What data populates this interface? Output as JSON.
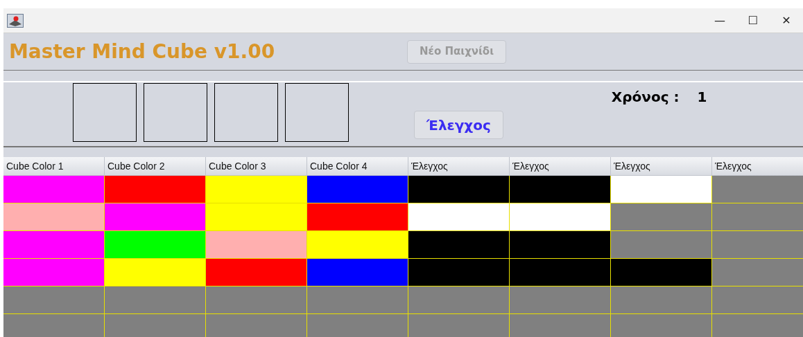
{
  "window": {
    "title_buttons": [
      "—",
      "☐",
      "✕"
    ]
  },
  "header": {
    "title": "Master Mind Cube v1.00",
    "new_game_button": {
      "label": "Νέο Παιχνίδι",
      "disabled": true
    }
  },
  "guess_slots": [
    {
      "filled": false
    },
    {
      "filled": false
    },
    {
      "filled": false
    },
    {
      "filled": false
    }
  ],
  "check_button": {
    "label": "Έλεγχος"
  },
  "timer": {
    "label": "Χρόνος :",
    "value": "1"
  },
  "table": {
    "columns": [
      "Cube Color 1",
      "Cube Color 2",
      "Cube Color 3",
      "Cube Color 4",
      "Έλεγχος",
      "Έλεγχος",
      "Έλεγχος",
      "Έλεγχος"
    ],
    "rows": [
      {
        "cells": [
          {
            "color": "#ff00ff"
          },
          {
            "color": "#ff0000"
          },
          {
            "color": "#ffff00"
          },
          {
            "color": "#0000ff"
          },
          {
            "color": "#000000"
          },
          {
            "color": "#000000"
          },
          {
            "color": "#ffffff"
          },
          {
            "color": "#808080"
          }
        ]
      },
      {
        "cells": [
          {
            "color": "#ffafaf"
          },
          {
            "color": "#ff00ff"
          },
          {
            "color": "#ffff00"
          },
          {
            "color": "#ff0000"
          },
          {
            "color": "#ffffff"
          },
          {
            "color": "#ffffff"
          },
          {
            "color": "#808080"
          },
          {
            "color": "#808080"
          }
        ]
      },
      {
        "cells": [
          {
            "color": "#ff00ff"
          },
          {
            "color": "#00ff00"
          },
          {
            "color": "#ffafaf"
          },
          {
            "color": "#ffff00"
          },
          {
            "color": "#000000"
          },
          {
            "color": "#000000"
          },
          {
            "color": "#808080"
          },
          {
            "color": "#808080"
          }
        ]
      },
      {
        "cells": [
          {
            "color": "#ff00ff"
          },
          {
            "color": "#ffff00"
          },
          {
            "color": "#ff0000"
          },
          {
            "color": "#0000ff"
          },
          {
            "color": "#000000"
          },
          {
            "color": "#000000"
          },
          {
            "color": "#000000"
          },
          {
            "color": "#808080"
          }
        ]
      },
      {
        "cells": [
          {
            "color": "#808080"
          },
          {
            "color": "#808080"
          },
          {
            "color": "#808080"
          },
          {
            "color": "#808080"
          },
          {
            "color": "#808080"
          },
          {
            "color": "#808080"
          },
          {
            "color": "#808080"
          },
          {
            "color": "#808080"
          }
        ]
      },
      {
        "cells": [
          {
            "color": "#808080"
          },
          {
            "color": "#808080"
          },
          {
            "color": "#808080"
          },
          {
            "color": "#808080"
          },
          {
            "color": "#808080"
          },
          {
            "color": "#808080"
          },
          {
            "color": "#808080"
          },
          {
            "color": "#808080"
          }
        ]
      }
    ]
  }
}
